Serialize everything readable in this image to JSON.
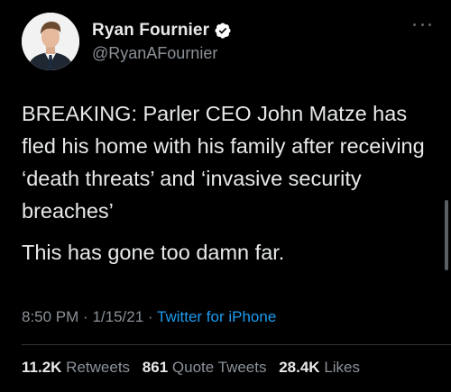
{
  "author": {
    "display_name": "Ryan Fournier",
    "handle": "@RyanAFournier",
    "verified": true,
    "avatar": "profile-photo"
  },
  "tweet": {
    "paragraphs": [
      "BREAKING: Parler CEO John Matze has fled his home with his family after receiving ‘death threats’ and ‘invasive security breaches’",
      "This has gone too damn far."
    ],
    "time": "8:50 PM",
    "date": "1/15/21",
    "separator": "·",
    "source": "Twitter for iPhone"
  },
  "stats": {
    "retweets_count": "11.2K",
    "retweets_label": "Retweets",
    "quote_tweets_count": "861",
    "quote_tweets_label": "Quote Tweets",
    "likes_count": "28.4K",
    "likes_label": "Likes"
  },
  "colors": {
    "background": "#000000",
    "text": "#e7e9ea",
    "secondary": "#8b9198",
    "link": "#1d9bf0",
    "verified": "#1d9bf0"
  }
}
